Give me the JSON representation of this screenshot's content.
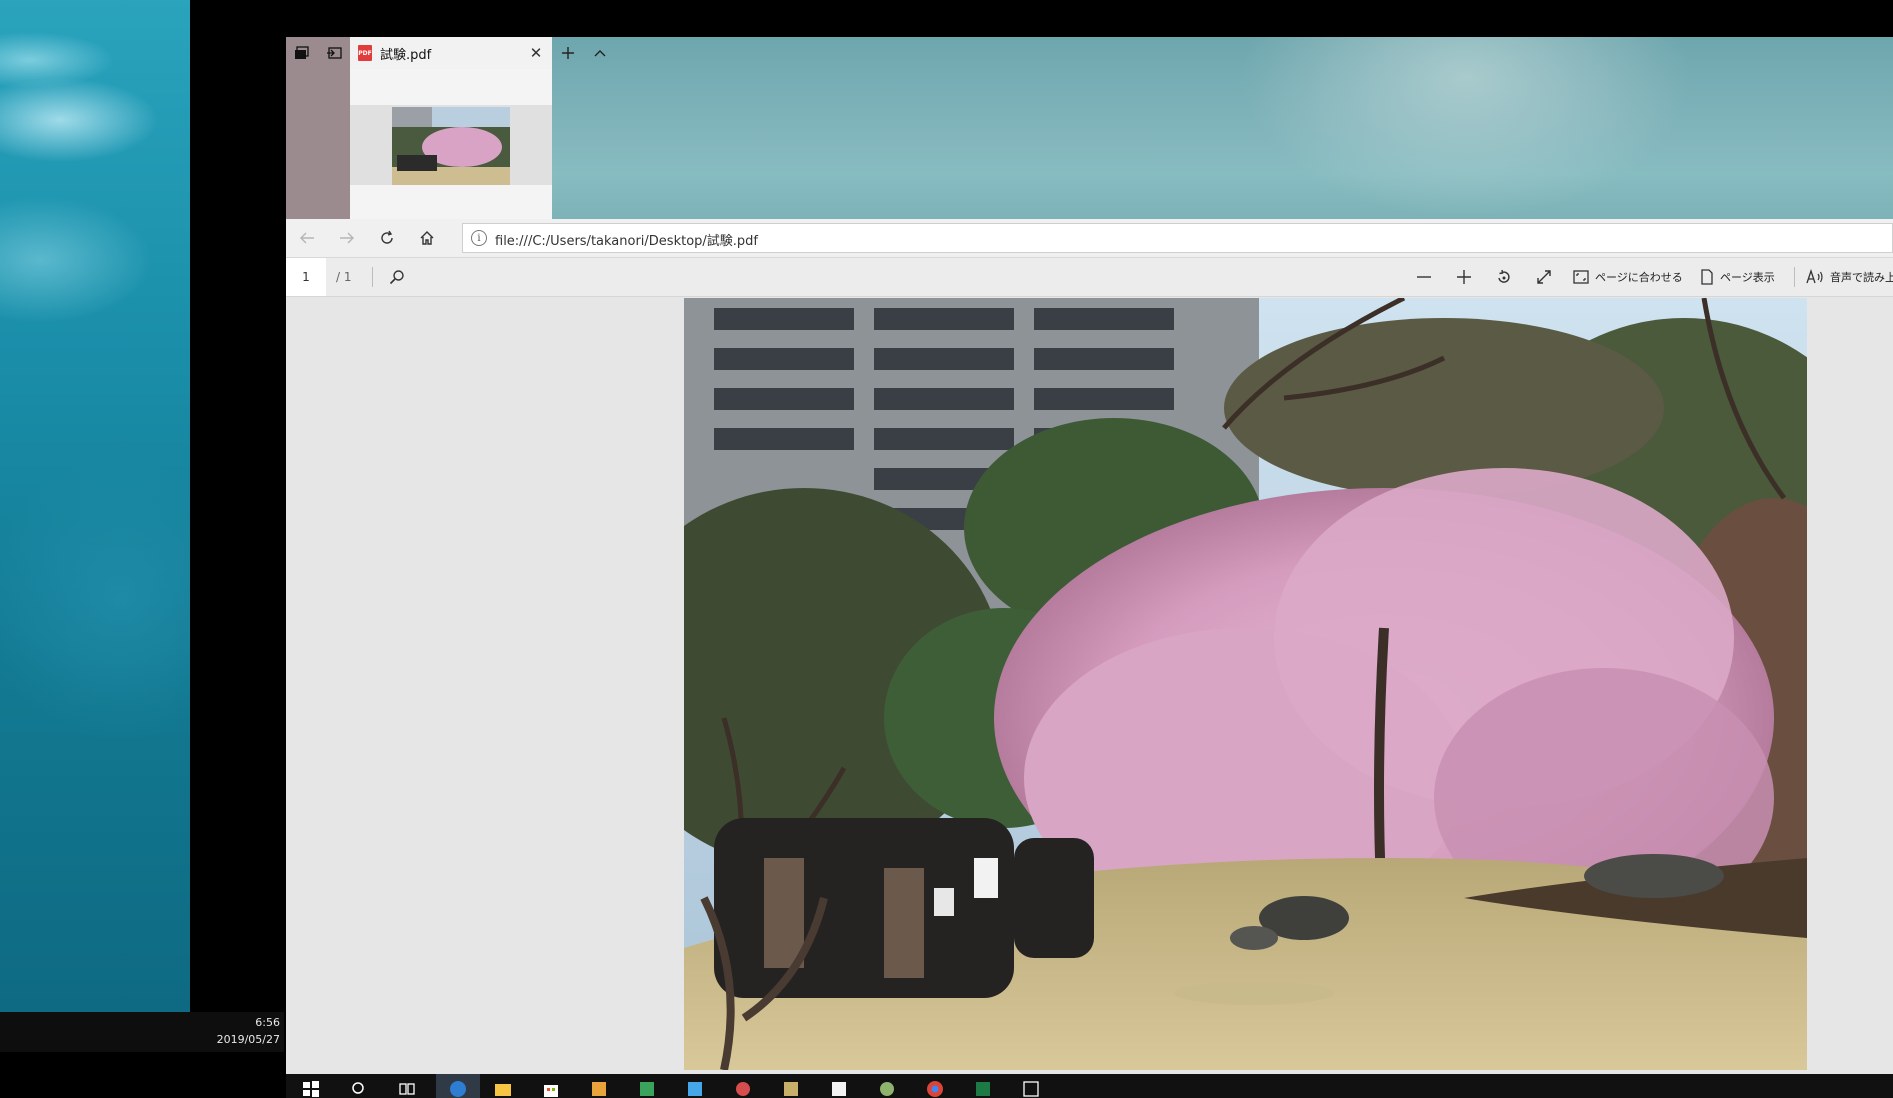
{
  "desktop": {
    "clock_time": "6:56",
    "clock_date": "2019/05/27"
  },
  "browser": {
    "tab_title": "試験.pdf",
    "tab_icon": "pdf-file-icon",
    "url": "file:///C:/Users/takanori/Desktop/試験.pdf",
    "nav": {
      "back_icon": "back-arrow-icon",
      "forward_icon": "forward-arrow-icon",
      "refresh_icon": "refresh-icon",
      "home_icon": "home-icon"
    }
  },
  "pdf_toolbar": {
    "current_page": "1",
    "total_pages": "/ 1",
    "fit_page_label": "ページに合わせる",
    "page_view_label": "ページ表示",
    "read_aloud_label": "音声で読み上げ"
  },
  "document": {
    "content": "photograph of a weeping cherry tree in bloom with a queue of visitors beside an office building"
  },
  "colors": {
    "tab_bar": "#7fb3ba",
    "window_bg": "#e6e6e6",
    "taskbar": "#111111",
    "pdf_icon_red": "#e23b3b",
    "active_task_accent": "#2d7dd2"
  },
  "taskbar": {
    "icons": [
      "windows-start-icon",
      "search-icon",
      "task-view-icon",
      "edge-icon",
      "file-explorer-icon",
      "store-icon",
      "app-icon",
      "excel-icon",
      "app-icon",
      "app-icon",
      "app-icon",
      "app-icon",
      "app-icon",
      "chrome-icon",
      "excel-icon",
      "photos-icon"
    ]
  }
}
